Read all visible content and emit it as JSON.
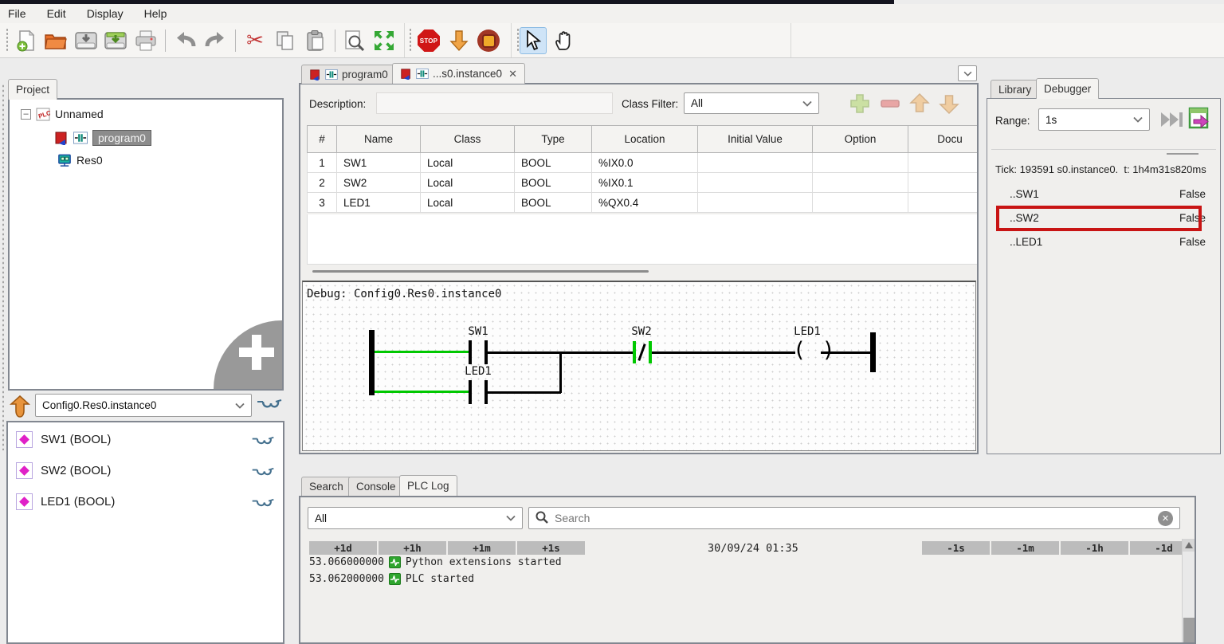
{
  "menu": {
    "items": [
      "File",
      "Edit",
      "Display",
      "Help"
    ]
  },
  "icons": {
    "close": "✕",
    "stop_label": "STOP",
    "expander_collapse": "–",
    "plc_label": "PLC"
  },
  "project_panel": {
    "tab_label": "Project",
    "tree": {
      "root": "Unnamed",
      "child1": "program0",
      "child2": "Res0"
    }
  },
  "instance_panel": {
    "selector_value": "Config0.Res0.instance0",
    "variables": [
      {
        "label": "SW1 (BOOL)"
      },
      {
        "label": "SW2 (BOOL)"
      },
      {
        "label": "LED1 (BOOL)"
      }
    ]
  },
  "editor": {
    "tabs": {
      "tab1": "program0",
      "tab2": "...s0.instance0"
    },
    "description_label": "Description:",
    "class_filter_label": "Class Filter:",
    "class_filter_value": "All",
    "table": {
      "headers": [
        "#",
        "Name",
        "Class",
        "Type",
        "Location",
        "Initial Value",
        "Option",
        "Docu"
      ],
      "rows": [
        [
          "1",
          "SW1",
          "Local",
          "BOOL",
          "%IX0.0",
          "",
          "",
          ""
        ],
        [
          "2",
          "SW2",
          "Local",
          "BOOL",
          "%IX0.1",
          "",
          "",
          ""
        ],
        [
          "3",
          "LED1",
          "Local",
          "BOOL",
          "%QX0.4",
          "",
          "",
          ""
        ]
      ]
    },
    "debug_header": "Debug: Config0.Res0.instance0",
    "ladder": {
      "contact1": "SW1",
      "contact2": "SW2",
      "contact3": "LED1",
      "coil": "LED1"
    }
  },
  "debugger_panel": {
    "tab_library": "Library",
    "tab_debugger": "Debugger",
    "range_label": "Range:",
    "range_value": "1s",
    "tick_text": "Tick: 193591 s0.instance0.  t: 1h4m31s820ms",
    "variables": [
      {
        "name": "..SW1",
        "value": "False"
      },
      {
        "name": "..SW2",
        "value": "False",
        "highlighted": true
      },
      {
        "name": "..LED1",
        "value": "False"
      }
    ]
  },
  "log_panel": {
    "tab_search": "Search",
    "tab_console": "Console",
    "tab_plclog": "PLC Log",
    "filter_value": "All",
    "search_placeholder": "Search",
    "buttons_left": [
      "+1d",
      "+1h",
      "+1m",
      "+1s"
    ],
    "timestamp": "30/09/24 01:35",
    "buttons_right": [
      "-1s",
      "-1m",
      "-1h",
      "-1d"
    ],
    "entries": [
      {
        "time": "53.066000000",
        "message": "Python extensions started"
      },
      {
        "time": "53.062000000",
        "message": "PLC started"
      }
    ]
  },
  "colors": {
    "wire_active": "#00c800",
    "annotation_red": "#c81414",
    "selection_blue": "#cfe4f7"
  }
}
